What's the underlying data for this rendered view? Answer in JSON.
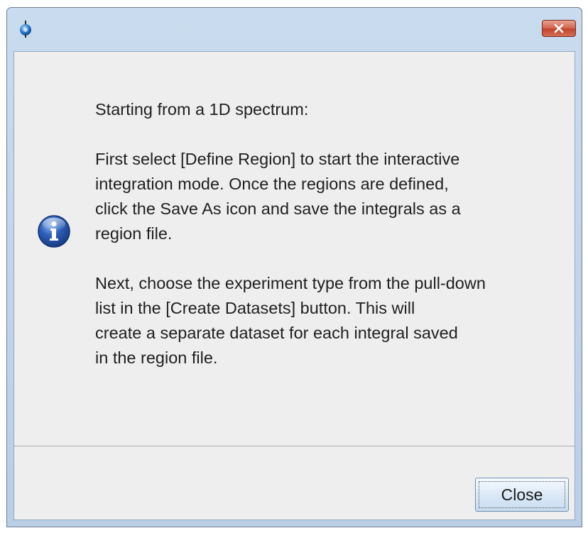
{
  "window": {
    "app_icon": "app-logo-icon",
    "title_close_icon": "close-icon"
  },
  "dialog": {
    "icon": "info-icon",
    "paragraphs": [
      "Starting from a 1D spectrum:",
      "First select [Define Region] to start the interactive\nintegration mode. Once the regions are defined,\nclick the Save As icon and save the integrals as a\nregion file.",
      "Next, choose the experiment type from the pull-down\nlist in the [Create Datasets] button. This will\ncreate a separate dataset for each integral saved\nin the region file."
    ],
    "close_label": "Close"
  },
  "colors": {
    "frame": "#bcd2e8",
    "client": "#eeeeee",
    "close_x": "#c44a33"
  }
}
